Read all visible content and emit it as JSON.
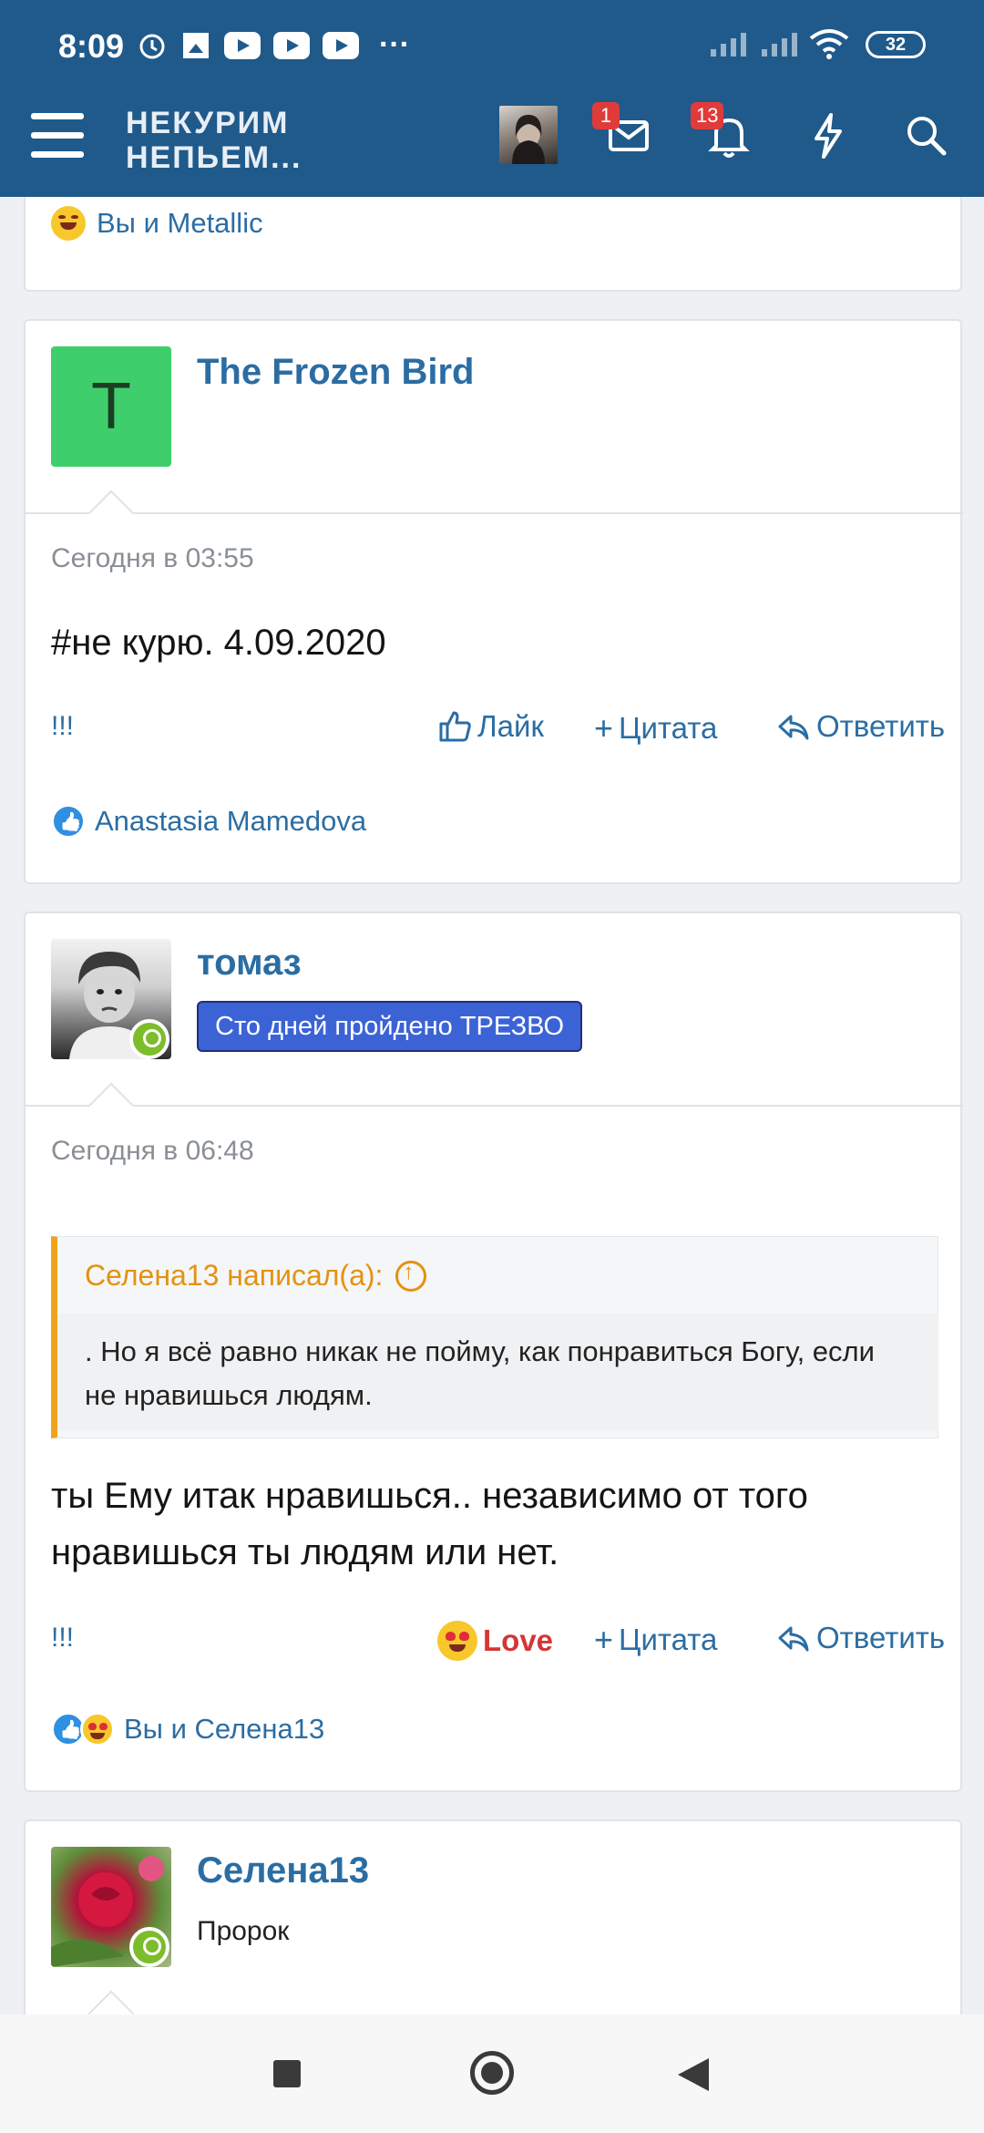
{
  "status_bar": {
    "time": "8:09",
    "more": "···",
    "battery": "32"
  },
  "header": {
    "logo_line1": "НЕКУРИМ",
    "logo_line2": "НЕПЬЕМ...",
    "messages_badge": "1",
    "alerts_badge": "13",
    "colors": {
      "bar": "#1f5a8b",
      "badge": "#e03b3b"
    }
  },
  "prev_post": {
    "reactions_text": "Вы и Metallic",
    "reaction_icon": "rofl-emoji"
  },
  "post1": {
    "avatar_letter": "T",
    "avatar_color": "#3ecf6c",
    "username": "The Frozen Bird",
    "date": "Сегодня в 03:55",
    "message": "#не курю. 4.09.2020",
    "actions": {
      "bang": "!!!",
      "like": "Лайк",
      "quote": "Цитата",
      "reply": "Ответить"
    },
    "reactions_text": "Anastasia Mamedova",
    "reaction_icon": "like-emoji"
  },
  "post2": {
    "username": "томаз",
    "banner": "Сто дней пройдено ТРЕЗВО",
    "date": "Сегодня в 06:48",
    "quote_author": "Селена13 написал(а):",
    "quote_text": ". Но я всё равно никак не пойму, как понравиться Богу, если не нравишься людям.",
    "message": "ты Ему итак нравишься.. независимо от того нравишься ты людям или нет.",
    "actions": {
      "bang": "!!!",
      "love": "Love",
      "quote": "Цитата",
      "reply": "Ответить"
    },
    "reactions_text": "Вы и Селена13",
    "reaction_icons": [
      "like-emoji",
      "heart-eyes-emoji"
    ]
  },
  "post3": {
    "username": "Селена13",
    "role": "Пророк"
  }
}
